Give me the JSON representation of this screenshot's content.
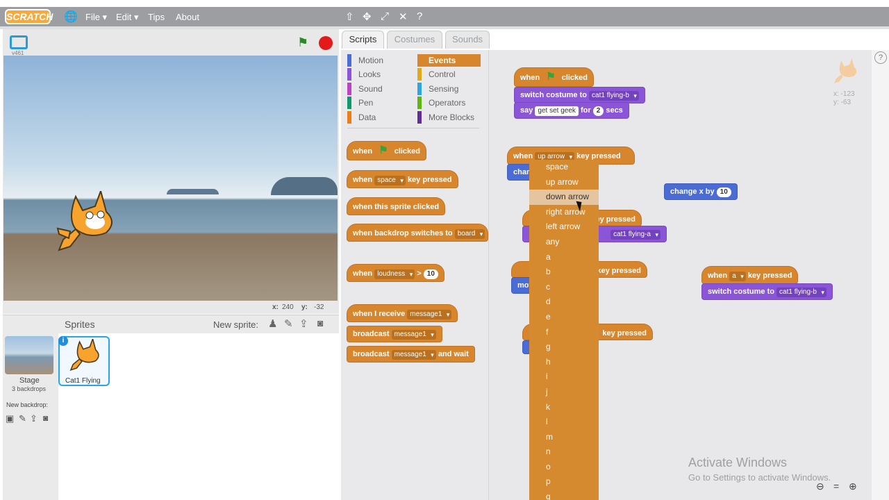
{
  "topbar": {
    "logo": "SCRATCH",
    "menu": [
      "File ▾",
      "Edit ▾",
      "Tips",
      "About"
    ]
  },
  "stage": {
    "version": "v461",
    "x_label": "x:",
    "x_value": "240",
    "y_label": "y:",
    "y_value": "-32"
  },
  "sprites": {
    "title": "Sprites",
    "new_sprite": "New sprite:",
    "stage_label": "Stage",
    "stage_backdrops": "3 backdrops",
    "new_backdrop": "New backdrop:",
    "sprite_name": "Cat1 Flying"
  },
  "tabs": [
    "Scripts",
    "Costumes",
    "Sounds"
  ],
  "categories": [
    {
      "label": "Motion",
      "color": "#4a6cd4"
    },
    {
      "label": "Events",
      "color": "#d7862e"
    },
    {
      "label": "Looks",
      "color": "#8a55d7"
    },
    {
      "label": "Control",
      "color": "#e1a91a"
    },
    {
      "label": "Sound",
      "color": "#bb42c3"
    },
    {
      "label": "Sensing",
      "color": "#2ca5e2"
    },
    {
      "label": "Pen",
      "color": "#0e9a6c"
    },
    {
      "label": "Operators",
      "color": "#5cb712"
    },
    {
      "label": "Data",
      "color": "#ee7d16"
    },
    {
      "label": "More Blocks",
      "color": "#632d99"
    }
  ],
  "palette": {
    "when": "when",
    "clicked": "clicked",
    "space": "space",
    "key_pressed": "key pressed",
    "sprite_clicked": "when this sprite clicked",
    "backdrop_switches": "when backdrop switches to",
    "board": "board",
    "loudness": "loudness",
    "gt": ">",
    "ten": "10",
    "receive": "when I receive",
    "message1": "message1",
    "broadcast": "broadcast",
    "and_wait": "and wait"
  },
  "scripts": {
    "switch_costume": "switch costume to",
    "cat_b": "cat1 flying-b",
    "cat_a": "cat1 flying-a",
    "say": "say",
    "say_text": "get set geek",
    "for": "for",
    "two": "2",
    "secs": "secs",
    "up_arrow": "up arrow",
    "change_x": "change x by",
    "change_x_val": "10",
    "a_key": "a",
    "cham": "cham",
    "mov": "mov",
    "sprite_x": "x: -123",
    "sprite_y": "y: -63"
  },
  "dropdown": {
    "options": [
      "space",
      "up arrow",
      "down arrow",
      "right arrow",
      "left arrow",
      "any",
      "a",
      "b",
      "c",
      "d",
      "e",
      "f",
      "g",
      "h",
      "i",
      "j",
      "k",
      "l",
      "m",
      "n",
      "o",
      "p",
      "q"
    ],
    "selected": "down arrow"
  },
  "watermark": {
    "title": "Activate Windows",
    "subtitle": "Go to Settings to activate Windows."
  }
}
